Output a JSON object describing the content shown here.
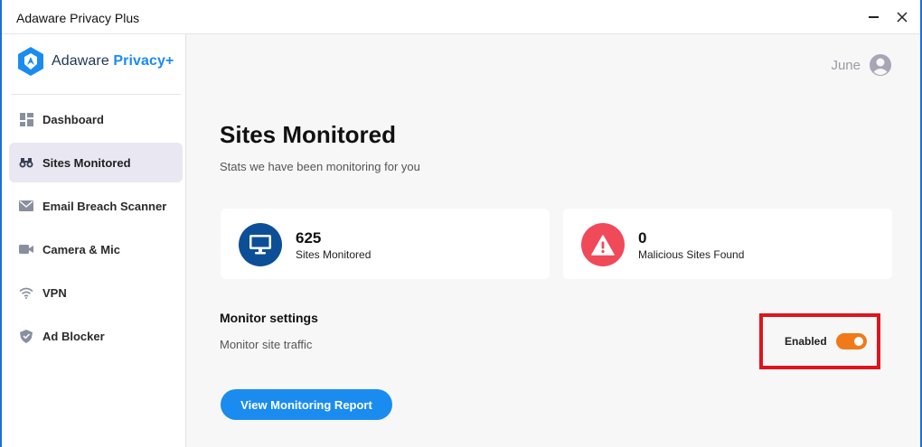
{
  "window": {
    "title": "Adaware Privacy Plus"
  },
  "brand": {
    "name_prefix": "Adaware ",
    "name_suffix": "Privacy+"
  },
  "sidebar": {
    "items": [
      {
        "label": "Dashboard",
        "icon": "dashboard-icon",
        "active": false
      },
      {
        "label": "Sites Monitored",
        "icon": "binoculars-icon",
        "active": true
      },
      {
        "label": "Email Breach Scanner",
        "icon": "envelope-icon",
        "active": false
      },
      {
        "label": "Camera & Mic",
        "icon": "camera-icon",
        "active": false
      },
      {
        "label": "VPN",
        "icon": "wifi-icon",
        "active": false
      },
      {
        "label": "Ad Blocker",
        "icon": "shield-icon",
        "active": false
      }
    ]
  },
  "user": {
    "name": "June"
  },
  "main": {
    "title": "Sites Monitored",
    "subtitle": "Stats we have been monitoring for you",
    "cards": [
      {
        "value": "625",
        "label": "Sites Monitored",
        "icon": "monitor-icon",
        "color": "#0d4f96"
      },
      {
        "value": "0",
        "label": "Malicious Sites Found",
        "icon": "warning-icon",
        "color": "#f0495a"
      }
    ],
    "monitor_settings": {
      "title": "Monitor settings",
      "subtitle": "Monitor site traffic",
      "toggle_label": "Enabled",
      "toggle_on": true
    },
    "report_button": "View Monitoring Report"
  },
  "colors": {
    "accent": "#1a8cf0",
    "toggle": "#f07a1a",
    "highlight": "#e0141c",
    "active_nav": "#e8e7f2"
  }
}
